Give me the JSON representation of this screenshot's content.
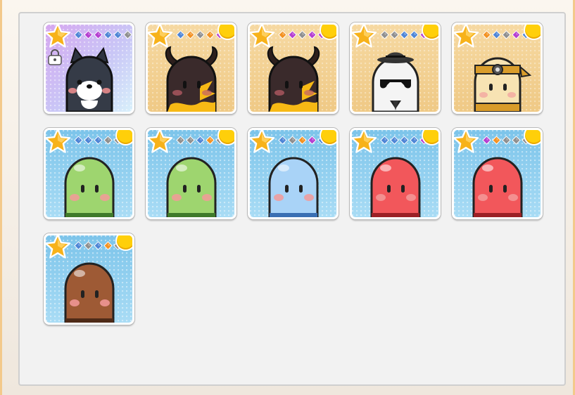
{
  "colors": {
    "gem_blue": "#4f86d6",
    "gem_purple": "#b53fd1",
    "gem_gray": "#8f8f8f",
    "gem_orange": "#f39222",
    "coin": "#ffcf0a",
    "star": "#f7b21a"
  },
  "cards": [
    {
      "id": "dog",
      "bg": "purple",
      "locked": true,
      "coin": false,
      "gems": [
        "blue",
        "purple",
        "purple",
        "blue",
        "blue",
        "gray"
      ],
      "character": "shiba-dog"
    },
    {
      "id": "demon-1",
      "bg": "gold",
      "locked": false,
      "coin": true,
      "gems": [
        "blue",
        "orange",
        "gray",
        "orange",
        "purple"
      ],
      "character": "horned-demon"
    },
    {
      "id": "demon-2",
      "bg": "gold",
      "locked": false,
      "coin": true,
      "gems": [
        "orange",
        "purple",
        "gray",
        "purple",
        "purple"
      ],
      "character": "horned-demon"
    },
    {
      "id": "agent",
      "bg": "gold",
      "locked": false,
      "coin": true,
      "gems": [
        "gray",
        "gray",
        "blue",
        "blue",
        "purple"
      ],
      "character": "sunglasses-agent"
    },
    {
      "id": "ninja",
      "bg": "gold",
      "locked": false,
      "coin": true,
      "gems": [
        "orange",
        "blue",
        "gray",
        "purple",
        "blue"
      ],
      "character": "ninja-blob"
    },
    {
      "id": "green-1",
      "bg": "blue",
      "locked": false,
      "coin": true,
      "gems": [
        "blue",
        "blue",
        "blue",
        "gray",
        "gray"
      ],
      "character": "green-blob"
    },
    {
      "id": "green-2",
      "bg": "blue",
      "locked": false,
      "coin": true,
      "gems": [
        "gray",
        "gray",
        "blue",
        "orange",
        "gray"
      ],
      "character": "green-blob"
    },
    {
      "id": "light-blue",
      "bg": "blue",
      "locked": false,
      "coin": true,
      "gems": [
        "blue",
        "gray",
        "orange",
        "purple",
        "blue"
      ],
      "character": "light-blue-blob"
    },
    {
      "id": "red-1",
      "bg": "blue",
      "locked": false,
      "coin": true,
      "gems": [
        "blue",
        "blue",
        "blue",
        "blue",
        "purple"
      ],
      "character": "red-blob"
    },
    {
      "id": "red-2",
      "bg": "blue",
      "locked": false,
      "coin": true,
      "gems": [
        "purple",
        "orange",
        "gray",
        "gray",
        "gray"
      ],
      "character": "red-blob"
    },
    {
      "id": "brown",
      "bg": "blue",
      "locked": false,
      "coin": true,
      "gems": [
        "blue",
        "gray",
        "blue",
        "orange",
        "gray"
      ],
      "character": "brown-blob"
    }
  ]
}
